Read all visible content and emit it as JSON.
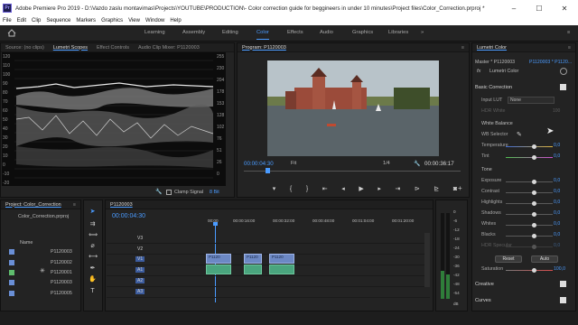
{
  "window": {
    "title": "Adobe Premiere Pro 2019 - D:\\Vazdo zaslu montavimas\\Projects\\YOUTUBE\\PRODUCTION\\- Color correction guide for beggineers in under 10 minutes\\Project files\\Color_Correction.prproj *",
    "app_icon": "Pr",
    "minimize": "–",
    "maximize": "☐",
    "close": "✕"
  },
  "menu": [
    "File",
    "Edit",
    "Clip",
    "Sequence",
    "Markers",
    "Graphics",
    "View",
    "Window",
    "Help"
  ],
  "workspaces": {
    "home_icon": "home-icon",
    "items": [
      "Learning",
      "Assembly",
      "Editing",
      "Color",
      "Effects",
      "Audio",
      "Graphics",
      "Libraries"
    ],
    "active": "Color",
    "more": "»",
    "menu_icon": "≡"
  },
  "source_panel": {
    "tabs": [
      "Source: (no clips)",
      "Lumetri Scopes",
      "Effect Controls",
      "Audio Clip Mixer: P1120003"
    ],
    "active_tab": "Lumetri Scopes",
    "scale_left": [
      "120",
      "110",
      "100",
      "90",
      "80",
      "70",
      "60",
      "50",
      "40",
      "30",
      "20",
      "10",
      "0",
      "-10",
      "-20"
    ],
    "scale_right": [
      "255",
      "230",
      "204",
      "178",
      "153",
      "128",
      "102",
      "76",
      "51",
      "26",
      "0"
    ],
    "clamp_signal": "Clamp Signal",
    "bit_depth": "8 Bit",
    "wrench": "🔧"
  },
  "program": {
    "title": "Program: P1120003",
    "menu_icon": "≡",
    "timecode": "00:00:04:30",
    "fit": "Fit",
    "quality": "1/4",
    "duration": "00:00:36:17",
    "controls": [
      "marker-icon",
      "in-point-icon",
      "out-point-icon",
      "go-to-in-icon",
      "step-back-icon",
      "play-icon",
      "step-forward-icon",
      "go-to-out-icon",
      "insert-icon",
      "overwrite-icon",
      "export-frame-icon"
    ],
    "control_glyphs": [
      "▾",
      "{",
      "}",
      "⇤",
      "◂",
      "▶",
      "▸",
      "⇥",
      "⊳",
      "⊵",
      "◙"
    ],
    "add": "+"
  },
  "project": {
    "tab": "Project: Color_Correction",
    "menu_icon": "≡",
    "file": "Color_Correction.prproj",
    "name_header": "Name",
    "items": [
      "P1120003",
      "P1120002",
      "P1120001",
      "P1120003",
      "P1120005"
    ],
    "colors": [
      "#6a8fd6",
      "#6a8fd6",
      "#5fbd6e",
      "#6a8fd6",
      "#6a8fd6"
    ]
  },
  "timeline": {
    "sequence": "P1120003",
    "timecode": "00:00:04:30",
    "ruler": [
      "00:00",
      "00:00:16:00",
      "00:00:32:00",
      "00:00:48:00",
      "00:01:04:00",
      "00:01:20:00"
    ],
    "video_tracks": [
      "V3",
      "V2",
      "V1"
    ],
    "audio_tracks": [
      "A1",
      "A2",
      "A3"
    ],
    "clip_label": "P1120",
    "meters": [
      "0",
      "-6",
      "-12",
      "-18",
      "-24",
      "-30",
      "-36",
      "-42",
      "-48",
      "-54",
      "dB"
    ]
  },
  "lumetri": {
    "tab": "Lumetri Color",
    "menu_icon": "≡",
    "master": "Master * P1120003",
    "clip": "P1120003 * P1120...",
    "effect": "Lumetri Color",
    "fx": "fx",
    "basic": "Basic Correction",
    "input_lut_label": "Input LUT",
    "input_lut_value": "None",
    "hdr_white": "HDR White",
    "hdr_white_value": "100",
    "white_balance": "White Balance",
    "wb_selector": "WB Selector",
    "tone": "Tone",
    "sliders": [
      {
        "label": "Temperature",
        "value": "0,0"
      },
      {
        "label": "Tint",
        "value": "0,0"
      },
      {
        "label": "Exposure",
        "value": "0,0"
      },
      {
        "label": "Contrast",
        "value": "0,0"
      },
      {
        "label": "Highlights",
        "value": "0,0"
      },
      {
        "label": "Shadows",
        "value": "0,0"
      },
      {
        "label": "Whites",
        "value": "0,0"
      },
      {
        "label": "Blacks",
        "value": "0,0"
      },
      {
        "label": "HDR Specular",
        "value": "0,0"
      }
    ],
    "reset": "Reset",
    "auto": "Auto",
    "saturation_label": "Saturation",
    "saturation_value": "100,0",
    "creative": "Creative",
    "curves": "Curves"
  }
}
